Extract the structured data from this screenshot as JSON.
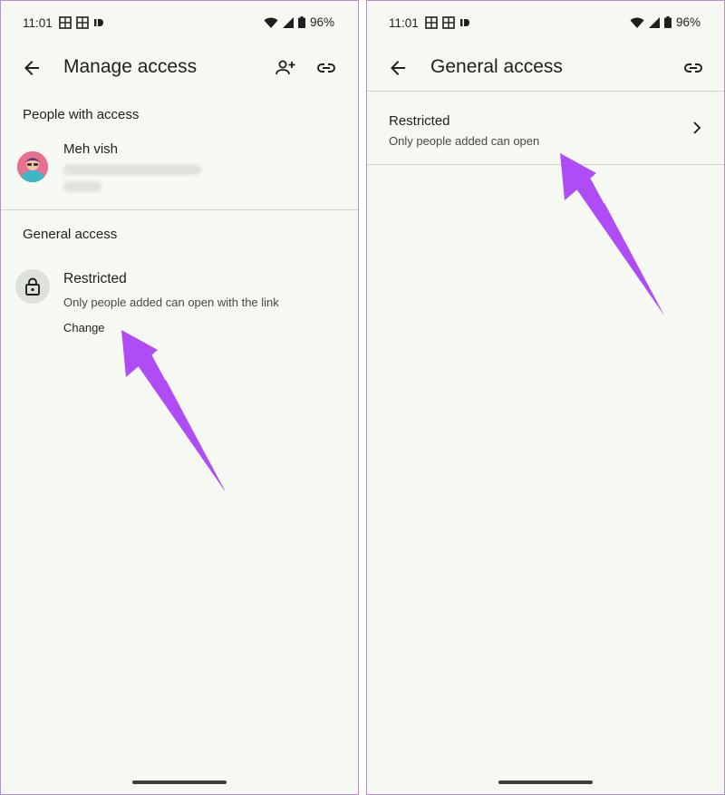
{
  "colors": {
    "annotation_arrow": "#b04cf6",
    "background": "#f6f9f1",
    "divider": "#cfd3cb"
  },
  "left_screen": {
    "status": {
      "time": "11:01",
      "battery": "96%"
    },
    "appbar": {
      "title": "Manage access",
      "icons": [
        "back-arrow-icon",
        "add-person-icon",
        "link-icon"
      ]
    },
    "people_section": {
      "heading": "People with access",
      "person_name": "Meh vish"
    },
    "general_section": {
      "heading": "General access",
      "access_title": "Restricted",
      "access_description": "Only people added can open with the link",
      "change_label": "Change"
    }
  },
  "right_screen": {
    "status": {
      "time": "11:01",
      "battery": "96%"
    },
    "appbar": {
      "title": "General access",
      "icons": [
        "back-arrow-icon",
        "link-icon"
      ]
    },
    "option": {
      "title": "Restricted",
      "description": "Only people added can open"
    }
  }
}
